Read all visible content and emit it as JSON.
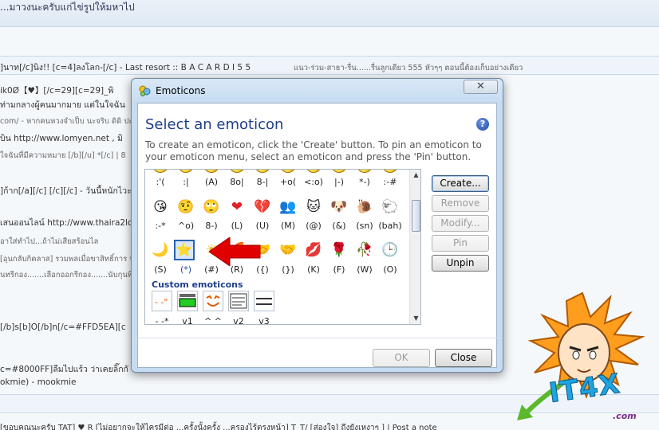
{
  "background": {
    "top_text": "...มาวงนะครับแก่ไข่รูปให้มหาไป",
    "last_row": {
      "text_a": "]นาท[/c]นิง!!  [c=4]ลงโลก-[/c] - Last resort  ::  B A C A R D I   5   5",
      "text_b": "แนว-ร่วม-สาธา-รื่น......รื่นลูกเดียว  555  หัวๆๆ       ตอนนี้ต้องเก็บอย่างเดียว"
    },
    "lines": [
      "ik0Ø【♥】[/c=29][c=29]_พิ",
      "ท่ามกลางผู้คนมากมาย แต่ในใจฉัน",
      "com/ - หากคนหวงจำเป็บ นะจริบ ดิดิ ปะ",
      "บิน  http://www.lomyen.net , มิ",
      "ใจฉันที่มีความหมาย  [/b][/u]  *[/c] |  8",
      "]ก้าก[/a][/c] [/c][/c] - วันนี้หนักไวะ55",
      "เสนออนไลน์  http://www.thaira2lov",
      "อาใส่ทำไป...ถ้าไม่เสียสร้อนไล",
      "[อุนกลับกิคลาส] รวมพลเมื่อขาสิทธิ์การ ปัจจุบั",
      "นทรีกอง.......เลือกออกรีกอง.......นับกุนที่",
      "[/b]s[b]O[/b]n[/c=#FFD5EA][c",
      "c=#8000FF]ลืมไปแร้ว ว่าเคยลิ๊กกั",
      "okmie)  - mookmie"
    ],
    "link_1": "http://www.lomyen.net",
    "link_2": "http://www.thaira2lov",
    "bottom": "[ขอบคุณนะครับ TAT] ♥ R [ไม่อยากจะให้ไครมีต่อ ...ครั้งนั้งครั้ง ...ครองไร้ตรงหน้า] T_T/ [ส่องใจ] ถึงยังเหงาๆ ] | Post a note"
  },
  "dialog": {
    "title": "Emoticons",
    "close_glyph": "✕",
    "heading": "Select an emoticon",
    "help_glyph": "?",
    "description": "To create an emoticon, click the 'Create' button. To pin an emoticon to your emoticon menu, select an emoticon and press the 'Pin' button.",
    "rows": [
      {
        "codes": [
          ":'(",
          ":|",
          "(A)",
          "8o|",
          "8-|",
          "+o(",
          "<:o)",
          "|-)",
          "*-)",
          ":-#"
        ],
        "icons": [
          "crying-face-icon",
          "straight-face-icon",
          "angel-face-icon",
          "teeth-face-icon",
          "eye-roll-face-icon",
          "sick-face-icon",
          "party-face-icon",
          "sleepy-face-icon",
          "thinking-face-icon",
          "shut-mouth-face-icon"
        ]
      },
      {
        "codes": [
          ":-*",
          "^o)",
          "8-)",
          "(L)",
          "(U)",
          "(M)",
          "(@)",
          "(&)",
          "(sn)",
          "(bah)"
        ],
        "glyphs": [
          "😘",
          "🤨",
          "🙄",
          "❤",
          "💔",
          "👥",
          "🐱",
          "🐶",
          "🐌",
          "🐑"
        ],
        "icons": [
          "secret-face-icon",
          "sarcastic-face-icon",
          "rolling-eyes-face-icon",
          "red-heart-icon",
          "broken-heart-icon",
          "messenger-icon",
          "cat-face-icon",
          "dog-face-icon",
          "snail-icon",
          "black-sheep-icon"
        ]
      },
      {
        "codes": [
          "(S)",
          "(*)",
          "(#)",
          "(R)",
          "({)",
          "(})",
          "(K)",
          "(F)",
          "(W)",
          "(O)"
        ],
        "glyphs": [
          "🌙",
          "⭐",
          "☀",
          "🌈",
          "🤝",
          "🤝",
          "💋",
          "🌹",
          "🥀",
          "🕒"
        ],
        "icons": [
          "sleeping-moon-icon",
          "star-icon",
          "sun-icon",
          "rainbow-icon",
          "left-hug-icon",
          "right-hug-icon",
          "red-lips-icon",
          "red-rose-icon",
          "wilted-rose-icon",
          "clock-icon"
        ]
      }
    ],
    "selected_code": "(*)",
    "custom_heading": "Custom emoticons",
    "custom": [
      {
        "code": "- -*"
      },
      {
        "code": "v1"
      },
      {
        "code": "^ ^"
      },
      {
        "code": "v2"
      },
      {
        "code": "v3"
      }
    ],
    "buttons": {
      "create": "Create...",
      "remove": "Remove",
      "modify": "Modify...",
      "pin": "Pin",
      "unpin": "Unpin",
      "ok": "OK",
      "close": "Close"
    }
  },
  "logo": {
    "text": "IT4X",
    "sub": ".com"
  },
  "colors": {
    "heading": "#1e3f8a",
    "selection": "#2a62b5",
    "arrow": "#e00000"
  }
}
